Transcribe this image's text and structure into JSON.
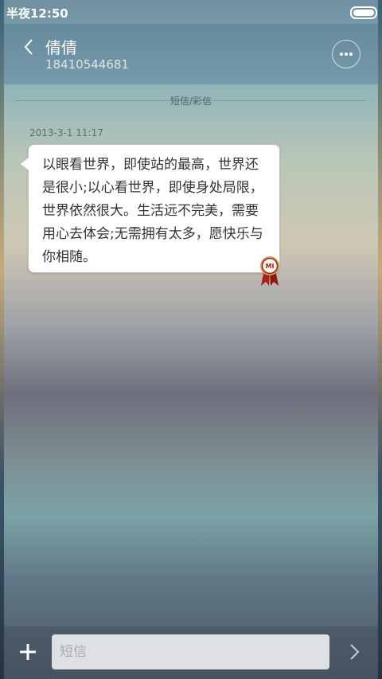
{
  "status_bar": {
    "time": "半夜12:50"
  },
  "header": {
    "contact_name": "倩倩",
    "contact_number": "18410544681",
    "back_icon": "chevron-left-icon",
    "more_icon": "more-dots-icon"
  },
  "conversation": {
    "channel_label": "短信/彩信",
    "messages": [
      {
        "time": "2013-3-1 11:17",
        "text": "以眼看世界，即使站的最高，世界还是很小;以心看世界，即使身处局限，世界依然很大。生活远不完美，需要用心去体会;无需拥有太多，愿快乐与你相随。",
        "badge_icon": "mi-award-ribbon-icon"
      }
    ]
  },
  "input_bar": {
    "placeholder": "短信",
    "add_icon": "plus-icon",
    "send_icon": "chevron-right-icon"
  },
  "colors": {
    "bubble": "#ffffff",
    "seal_red": "#a8201a"
  }
}
